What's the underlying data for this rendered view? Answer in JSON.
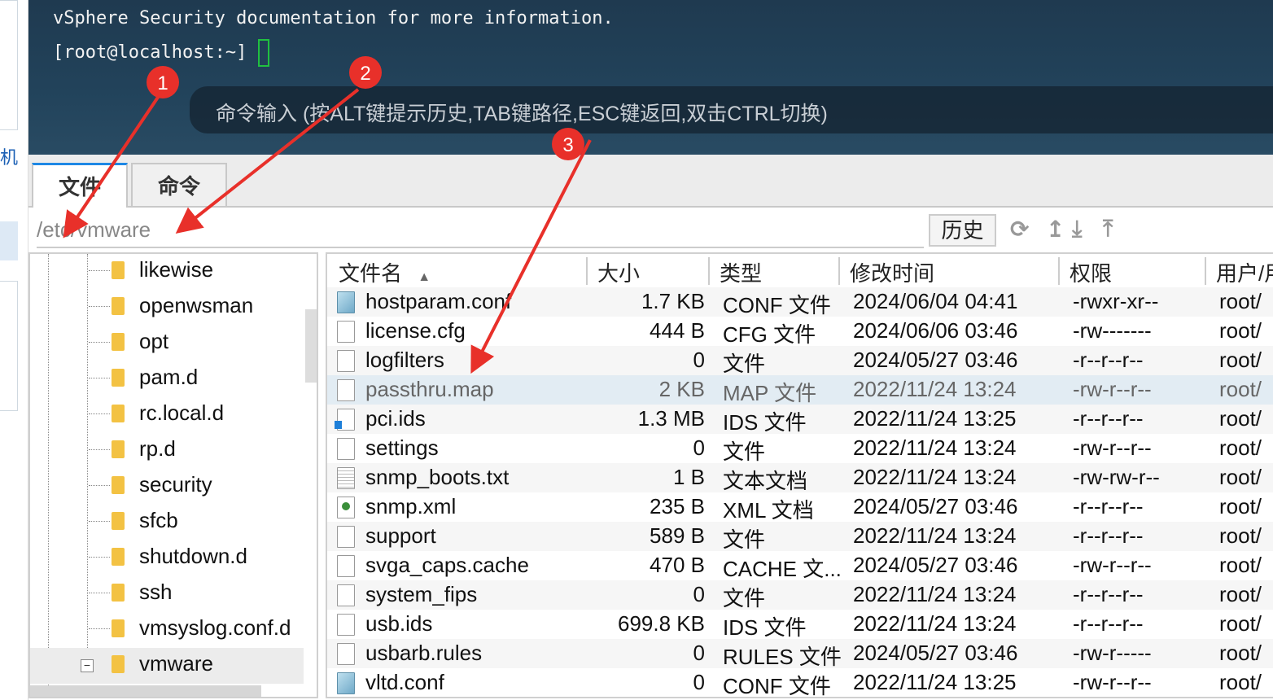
{
  "sidebar": {
    "partial_label": "机"
  },
  "terminal": {
    "line1": "vSphere Security documentation for more information.",
    "prompt": "[root@localhost:~]",
    "command_hint": "命令输入 (按ALT键提示历史,TAB键路径,ESC键返回,双击CTRL切换)"
  },
  "tabs": [
    {
      "label": "文件",
      "active": true
    },
    {
      "label": "命令",
      "active": false
    }
  ],
  "path": {
    "value": "/etc/vmware"
  },
  "toolbar": {
    "history_label": "历史",
    "icons": [
      "refresh-icon",
      "up-directory-icon",
      "download-icon",
      "upload-icon"
    ]
  },
  "tree": {
    "items": [
      {
        "label": "likewise"
      },
      {
        "label": "openwsman"
      },
      {
        "label": "opt"
      },
      {
        "label": "pam.d"
      },
      {
        "label": "rc.local.d"
      },
      {
        "label": "rp.d"
      },
      {
        "label": "security"
      },
      {
        "label": "sfcb"
      },
      {
        "label": "shutdown.d"
      },
      {
        "label": "ssh"
      },
      {
        "label": "vmsyslog.conf.d"
      },
      {
        "label": "vmware",
        "selected": true,
        "expanded": true
      }
    ]
  },
  "table": {
    "columns": [
      "文件名",
      "大小",
      "类型",
      "修改时间",
      "权限",
      "用户/用"
    ],
    "sort": {
      "column": "文件名",
      "direction": "asc"
    },
    "rows": [
      {
        "name": "hostparam.conf",
        "size": "1.7 KB",
        "type": "CONF 文件",
        "modified": "2024/06/04 04:41",
        "perm": "-rwxr-xr--",
        "owner": "root/",
        "icon": "conf"
      },
      {
        "name": "license.cfg",
        "size": "444 B",
        "type": "CFG 文件",
        "modified": "2024/06/06 03:46",
        "perm": "-rw-------",
        "owner": "root/",
        "icon": "file"
      },
      {
        "name": "logfilters",
        "size": "0",
        "type": "文件",
        "modified": "2024/05/27 03:46",
        "perm": "-r--r--r--",
        "owner": "root/",
        "icon": "file"
      },
      {
        "name": "passthru.map",
        "size": "2 KB",
        "type": "MAP 文件",
        "modified": "2022/11/24 13:24",
        "perm": "-rw-r--r--",
        "owner": "root/",
        "icon": "file",
        "selected": true
      },
      {
        "name": "pci.ids",
        "size": "1.3 MB",
        "type": "IDS 文件",
        "modified": "2022/11/24 13:25",
        "perm": "-r--r--r--",
        "owner": "root/",
        "icon": "ids"
      },
      {
        "name": "settings",
        "size": "0",
        "type": "文件",
        "modified": "2022/11/24 13:24",
        "perm": "-rw-r--r--",
        "owner": "root/",
        "icon": "file"
      },
      {
        "name": "snmp_boots.txt",
        "size": "1 B",
        "type": "文本文档",
        "modified": "2022/11/24 13:24",
        "perm": "-rw-rw-r--",
        "owner": "root/",
        "icon": "txt"
      },
      {
        "name": "snmp.xml",
        "size": "235 B",
        "type": "XML 文档",
        "modified": "2024/05/27 03:46",
        "perm": "-r--r--r--",
        "owner": "root/",
        "icon": "xml"
      },
      {
        "name": "support",
        "size": "589 B",
        "type": "文件",
        "modified": "2022/11/24 13:24",
        "perm": "-r--r--r--",
        "owner": "root/",
        "icon": "file"
      },
      {
        "name": "svga_caps.cache",
        "size": "470 B",
        "type": "CACHE 文...",
        "modified": "2024/05/27 03:46",
        "perm": "-rw-r--r--",
        "owner": "root/",
        "icon": "file"
      },
      {
        "name": "system_fips",
        "size": "0",
        "type": "文件",
        "modified": "2022/11/24 13:24",
        "perm": "-r--r--r--",
        "owner": "root/",
        "icon": "file"
      },
      {
        "name": "usb.ids",
        "size": "699.8 KB",
        "type": "IDS 文件",
        "modified": "2022/11/24 13:24",
        "perm": "-r--r--r--",
        "owner": "root/",
        "icon": "file"
      },
      {
        "name": "usbarb.rules",
        "size": "0",
        "type": "RULES 文件",
        "modified": "2024/05/27 03:46",
        "perm": "-rw-r-----",
        "owner": "root/",
        "icon": "file"
      },
      {
        "name": "vltd.conf",
        "size": "0",
        "type": "CONF 文件",
        "modified": "2022/11/24 13:25",
        "perm": "-rw-r--r--",
        "owner": "root/",
        "icon": "conf"
      }
    ]
  },
  "annotations": {
    "color": "#e8302a",
    "markers": [
      "1",
      "2",
      "3"
    ]
  }
}
